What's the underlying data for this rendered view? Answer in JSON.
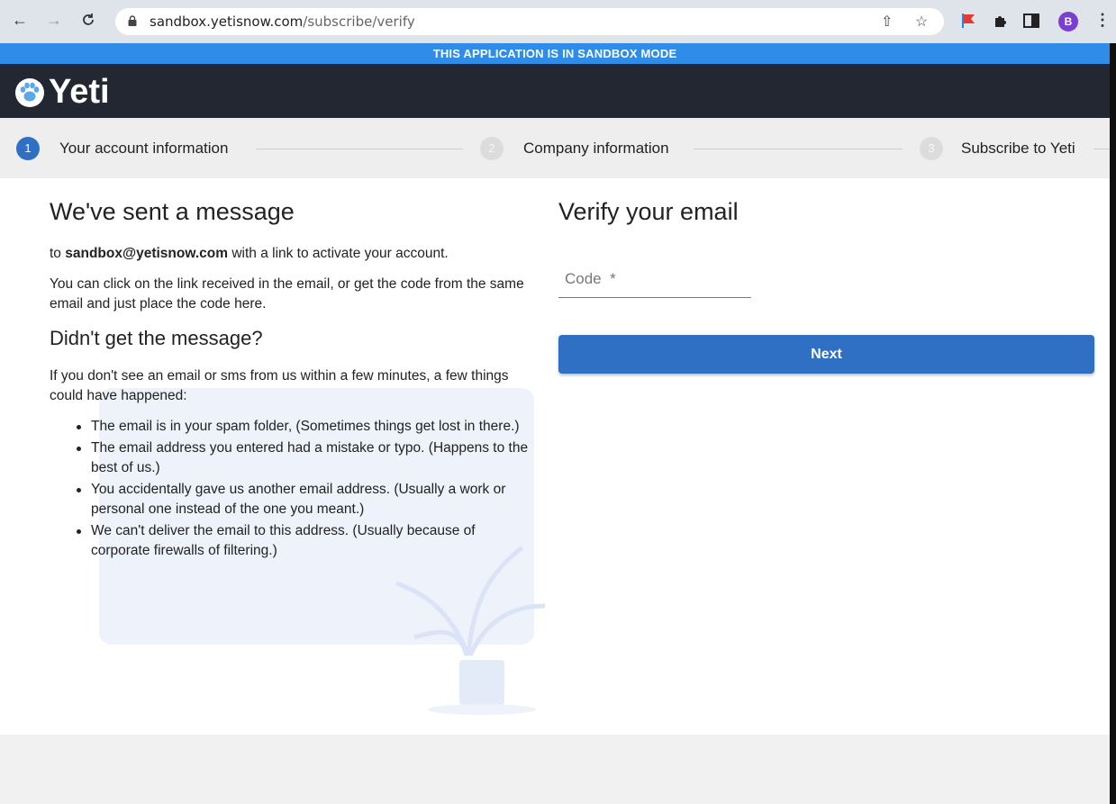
{
  "browser": {
    "url_host": "sandbox.yetisnow.com",
    "url_path": "/subscribe/verify",
    "avatar_letter": "B",
    "icons": [
      "back-arrow-icon",
      "forward-arrow-icon",
      "reload-icon",
      "lock-icon",
      "share-icon",
      "star-icon",
      "flag-extension-icon",
      "puzzle-icon",
      "sidepanel-icon",
      "kebab-menu-icon"
    ]
  },
  "banner": {
    "text": "THIS APPLICATION IS IN SANDBOX MODE"
  },
  "brand": {
    "name": "Yeti"
  },
  "stepper": {
    "steps": [
      {
        "number": "1",
        "label": "Your account information",
        "active": true
      },
      {
        "number": "2",
        "label": "Company information",
        "active": false
      },
      {
        "number": "3",
        "label": "Subscribe to Yeti",
        "active": false
      }
    ]
  },
  "left": {
    "title": "We've sent a message",
    "sent_prefix": "to ",
    "email": "sandbox@yetisnow.com",
    "sent_suffix": " with a link to activate your account.",
    "instructions": "You can click on the link received in the email, or get the code from the same email and just place the code here.",
    "subtitle": "Didn't get the message?",
    "intro": "If you don't see an email or sms from us within a few minutes, a few things could have happened:",
    "reasons": [
      "The email is in your spam folder, (Sometimes things get lost in there.)",
      "The email address you entered had a mistake or typo. (Happens to the best of us.)",
      "You accidentally gave us another email address. (Usually a work or personal one instead of the one you meant.)",
      "We can't deliver the email to this address. (Usually because of corporate firewalls of filtering.)"
    ]
  },
  "right": {
    "title": "Verify your email",
    "code_placeholder": "Code  *",
    "code_value": "",
    "next_label": "Next"
  },
  "colors": {
    "banner": "#2f8ce8",
    "header": "#222732",
    "primary": "#2f6fc4",
    "avatar": "#7a3fd1"
  }
}
